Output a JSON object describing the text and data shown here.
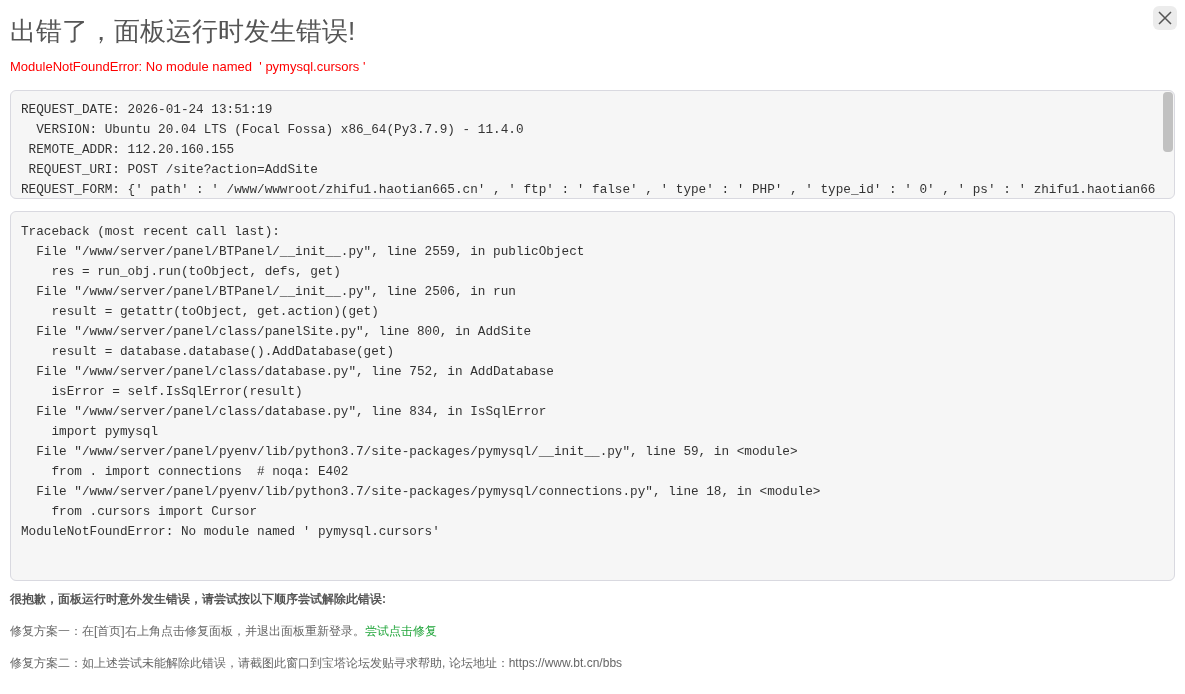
{
  "title": "出错了，面板运行时发生错误!",
  "error_message": "ModuleNotFoundError: No module named  ' pymysql.cursors '",
  "request_info": [
    "REQUEST_DATE: 2026-01-24 13:51:19",
    "  VERSION: Ubuntu 20.04 LTS (Focal Fossa) x86_64(Py3.7.9) - 11.4.0",
    " REMOTE_ADDR: 112.20.160.155",
    " REQUEST_URI: POST /site?action=AddSite",
    "REQUEST_FORM: {' path' : ' /www/wwwroot/zhifu1.haotian665.cn' , ' ftp' : ' false' , ' type' : ' PHP' , ' type_id' : ' 0' , ' ps' : ' zhifu1.haotian66"
  ],
  "traceback": [
    "Traceback (most recent call last):",
    "  File \"/www/server/panel/BTPanel/__init__.py\", line 2559, in publicObject",
    "    res = run_obj.run(toObject, defs, get)",
    "  File \"/www/server/panel/BTPanel/__init__.py\", line 2506, in run",
    "    result = getattr(toObject, get.action)(get)",
    "  File \"/www/server/panel/class/panelSite.py\", line 800, in AddSite",
    "    result = database.database().AddDatabase(get)",
    "  File \"/www/server/panel/class/database.py\", line 752, in AddDatabase",
    "    isError = self.IsSqlError(result)",
    "  File \"/www/server/panel/class/database.py\", line 834, in IsSqlError",
    "    import pymysql",
    "  File \"/www/server/panel/pyenv/lib/python3.7/site-packages/pymysql/__init__.py\", line 59, in <module>",
    "    from . import connections  # noqa: E402",
    "  File \"/www/server/panel/pyenv/lib/python3.7/site-packages/pymysql/connections.py\", line 18, in <module>",
    "    from .cursors import Cursor",
    "ModuleNotFoundError: No module named ' pymysql.cursors'"
  ],
  "help_heading": "很抱歉，面板运行时意外发生错误，请尝试按以下顺序尝试解除此错误:",
  "fixes": [
    {
      "text": "修复方案一：在[首页]右上角点击修复面板，并退出面板重新登录。",
      "link": "尝试点击修复"
    },
    {
      "text": "修复方案二：如上述尝试未能解除此错误，请截图此窗口到宝塔论坛发贴寻求帮助, 论坛地址：https://www.bt.cn/bbs"
    }
  ]
}
